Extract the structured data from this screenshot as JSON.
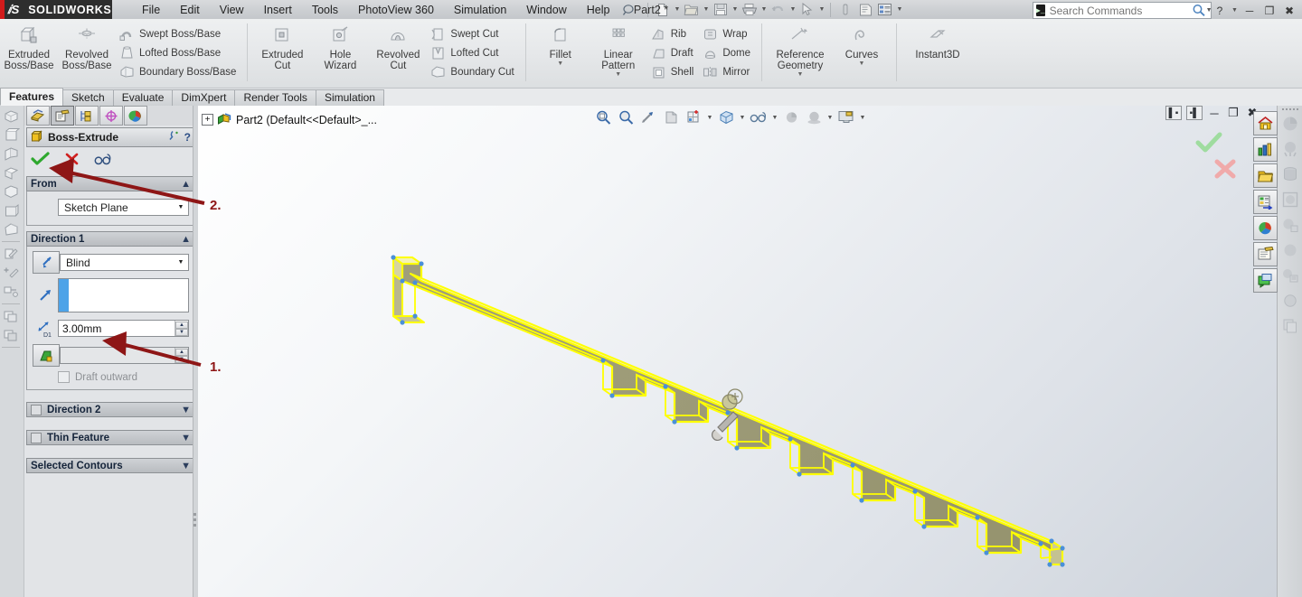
{
  "app": {
    "brand": "SOLIDWORKS",
    "doc_title": "Part2 *",
    "menus": [
      "File",
      "Edit",
      "View",
      "Insert",
      "Tools",
      "PhotoView 360",
      "Simulation",
      "Window",
      "Help"
    ],
    "window_buttons": [
      "minimize",
      "restore",
      "close"
    ]
  },
  "search": {
    "placeholder": "Search Commands",
    "icon": "command-search-icon"
  },
  "ribbon": {
    "groups": [
      {
        "big": [
          {
            "label": "Extruded\nBoss/Base",
            "icon": "extruded-boss-icon"
          },
          {
            "label": "Revolved\nBoss/Base",
            "icon": "revolved-boss-icon"
          }
        ],
        "small": [
          {
            "label": "Swept Boss/Base",
            "icon": "swept-boss-icon"
          },
          {
            "label": "Lofted Boss/Base",
            "icon": "lofted-boss-icon"
          },
          {
            "label": "Boundary Boss/Base",
            "icon": "boundary-boss-icon"
          }
        ]
      },
      {
        "big": [
          {
            "label": "Extruded\nCut",
            "icon": "extruded-cut-icon"
          },
          {
            "label": "Hole\nWizard",
            "icon": "hole-wizard-icon"
          },
          {
            "label": "Revolved\nCut",
            "icon": "revolved-cut-icon"
          }
        ],
        "small": [
          {
            "label": "Swept Cut",
            "icon": "swept-cut-icon"
          },
          {
            "label": "Lofted Cut",
            "icon": "lofted-cut-icon"
          },
          {
            "label": "Boundary Cut",
            "icon": "boundary-cut-icon"
          }
        ]
      },
      {
        "big": [
          {
            "label": "Fillet",
            "icon": "fillet-icon",
            "caret": true
          },
          {
            "label": "Linear\nPattern",
            "icon": "linear-pattern-icon",
            "caret": true
          }
        ],
        "small": [
          {
            "label": "Rib",
            "icon": "rib-icon"
          },
          {
            "label": "Draft",
            "icon": "draft-icon"
          },
          {
            "label": "Shell",
            "icon": "shell-icon"
          }
        ],
        "small2": [
          {
            "label": "Wrap",
            "icon": "wrap-icon"
          },
          {
            "label": "Dome",
            "icon": "dome-icon"
          },
          {
            "label": "Mirror",
            "icon": "mirror-icon"
          }
        ]
      },
      {
        "big": [
          {
            "label": "Reference\nGeometry",
            "icon": "reference-geometry-icon",
            "caret": true
          },
          {
            "label": "Curves",
            "icon": "curves-icon",
            "caret": true
          }
        ]
      },
      {
        "big": [
          {
            "label": "Instant3D",
            "icon": "instant3d-icon"
          }
        ]
      }
    ]
  },
  "command_tabs": [
    {
      "label": "Features",
      "active": true
    },
    {
      "label": "Sketch",
      "active": false
    },
    {
      "label": "Evaluate",
      "active": false
    },
    {
      "label": "DimXpert",
      "active": false
    },
    {
      "label": "Render Tools",
      "active": false
    },
    {
      "label": "Simulation",
      "active": false
    }
  ],
  "property_manager": {
    "tabs": [
      {
        "name": "feature-manager-tab",
        "selected": false
      },
      {
        "name": "property-manager-tab",
        "selected": true
      },
      {
        "name": "configuration-manager-tab",
        "selected": false
      },
      {
        "name": "dimxpert-manager-tab",
        "selected": false
      },
      {
        "name": "display-manager-tab",
        "selected": false
      }
    ],
    "title": "Boss-Extrude",
    "header_icons": [
      "pin-icon",
      "help-icon"
    ],
    "actions": [
      "ok-check-icon",
      "cancel-x-icon",
      "preview-glasses-icon"
    ],
    "from": {
      "section_label": "From",
      "value": "Sketch Plane"
    },
    "direction1": {
      "section_label": "Direction 1",
      "end_condition": "Blind",
      "direction_vector": "",
      "depth": "3.00mm",
      "draft_angle": "",
      "draft_outward_label": "Draft outward"
    },
    "collapsed_sections": [
      {
        "label": "Direction 2",
        "checkbox": true
      },
      {
        "label": "Thin Feature",
        "checkbox": true
      },
      {
        "label": "Selected Contours",
        "checkbox": false
      }
    ]
  },
  "graphics": {
    "tree_root": "Part2  (Default<<Default>_...",
    "toolbar": [
      {
        "name": "zoom-to-fit-icon",
        "caret": false
      },
      {
        "name": "zoom-to-area-icon",
        "caret": false
      },
      {
        "name": "previous-view-icon",
        "caret": false
      },
      {
        "name": "section-view-icon",
        "caret": false
      },
      {
        "name": "view-orientation-icon",
        "caret": true
      },
      {
        "name": "display-style-icon",
        "caret": true
      },
      {
        "name": "hide-show-items-icon",
        "caret": true
      },
      {
        "name": "edit-appearance-icon",
        "caret": false
      },
      {
        "name": "apply-scene-icon",
        "caret": true
      },
      {
        "name": "view-settings-icon",
        "caret": true
      }
    ],
    "window_controls": [
      "split-left-icon",
      "split-right-icon",
      "minimize-icon",
      "restore-icon",
      "close-icon"
    ],
    "confirm_corner": [
      "confirm-ok-icon",
      "confirm-cancel-icon"
    ],
    "flyout_toolbar": [
      "home-icon",
      "solidworks-resources-icon",
      "design-library-icon",
      "file-explorer-icon",
      "view-palette-icon",
      "appearances-scenes-icon",
      "custom-properties-icon"
    ],
    "task_pane": [
      "sphere-icon",
      "render-icon",
      "drum-icon",
      "sphere-window-icon",
      "sphere-copy-icon",
      "sphere-plain-icon",
      "sphere-list-icon",
      "circle-icon",
      "copy-icon"
    ]
  },
  "annotations": [
    {
      "label": "1.",
      "target": "depth-input",
      "color": "#8e1616"
    },
    {
      "label": "2.",
      "target": "ok-check-icon",
      "color": "#8e1616"
    }
  ],
  "model": {
    "description": "extruded sheet-metal style bracket with notched bottom edge",
    "face_color": "#9c9a77",
    "edge_color": "#ffff00",
    "top_face_color": "#f2f0aa",
    "vertex_color": "#4a90d9"
  }
}
